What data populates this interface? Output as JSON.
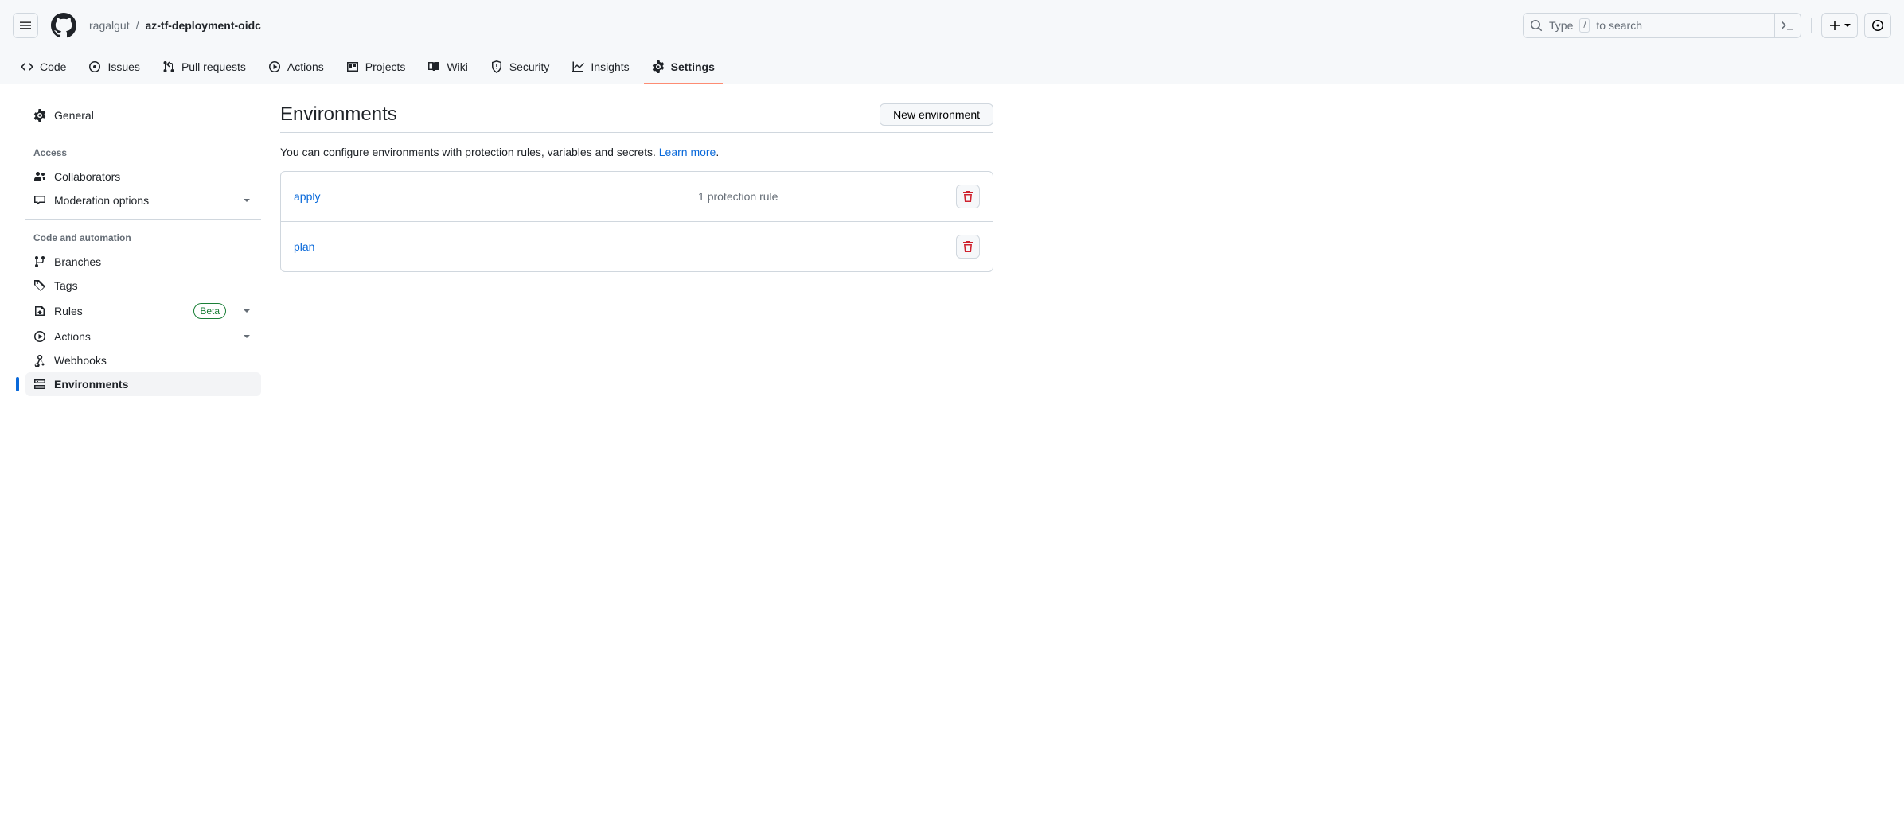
{
  "breadcrumb": {
    "owner": "ragalgut",
    "repo": "az-tf-deployment-oidc"
  },
  "search": {
    "prefix": "Type",
    "key": "/",
    "suffix": "to search"
  },
  "repo_nav": [
    {
      "label": "Code"
    },
    {
      "label": "Issues"
    },
    {
      "label": "Pull requests"
    },
    {
      "label": "Actions"
    },
    {
      "label": "Projects"
    },
    {
      "label": "Wiki"
    },
    {
      "label": "Security"
    },
    {
      "label": "Insights"
    },
    {
      "label": "Settings"
    }
  ],
  "sidebar": {
    "general": "General",
    "sections": {
      "access": {
        "title": "Access",
        "items": {
          "collaborators": "Collaborators",
          "moderation": "Moderation options"
        }
      },
      "code_automation": {
        "title": "Code and automation",
        "items": {
          "branches": "Branches",
          "tags": "Tags",
          "rules": "Rules",
          "rules_badge": "Beta",
          "actions": "Actions",
          "webhooks": "Webhooks",
          "environments": "Environments"
        }
      }
    }
  },
  "content": {
    "title": "Environments",
    "new_btn": "New environment",
    "desc": "You can configure environments with protection rules, variables and secrets. ",
    "learn_more": "Learn more",
    "environments": [
      {
        "name": "apply",
        "rule": "1 protection rule"
      },
      {
        "name": "plan",
        "rule": ""
      }
    ]
  }
}
